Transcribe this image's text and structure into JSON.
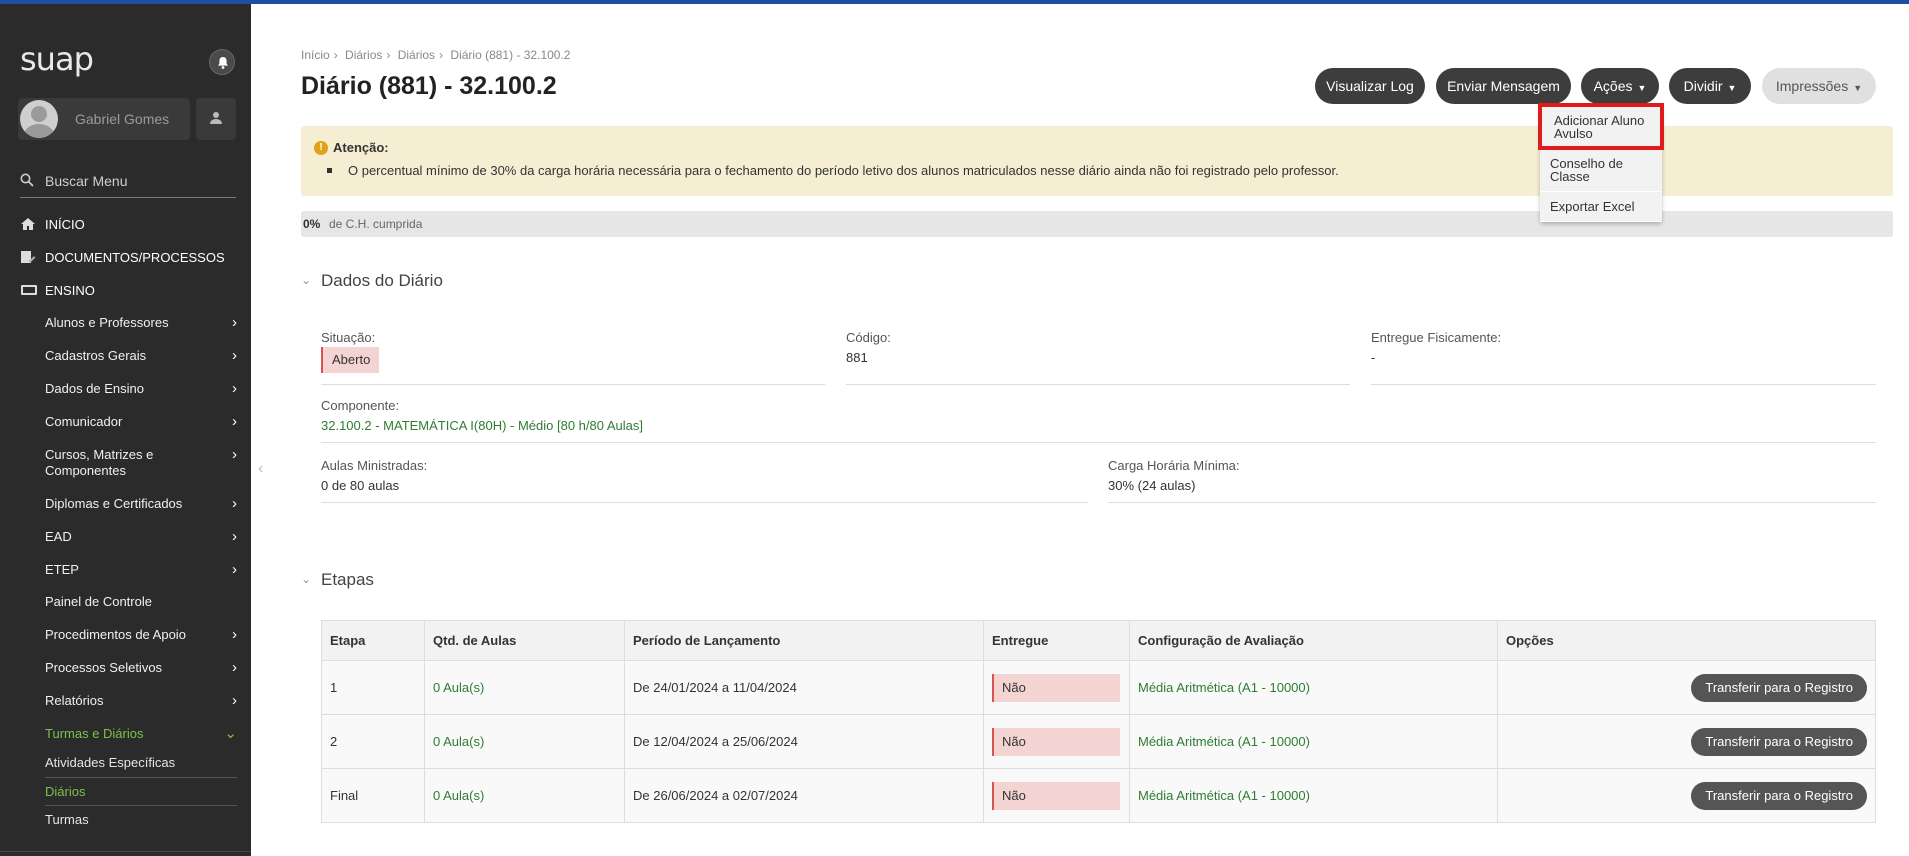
{
  "app": {
    "logo": "suap"
  },
  "user": {
    "name": "Gabriel Gomes"
  },
  "sidebar": {
    "search_placeholder": "Buscar Menu",
    "top_items": [
      {
        "label": "INÍCIO",
        "icon": "home-icon"
      },
      {
        "label": "DOCUMENTOS/PROCESSOS",
        "icon": "document-edit-icon"
      },
      {
        "label": "ENSINO",
        "icon": "ensino-icon"
      }
    ],
    "ensino_items": [
      "Alunos e Professores",
      "Cadastros Gerais",
      "Dados de Ensino",
      "Comunicador",
      "Cursos, Matrizes e Componentes",
      "Diplomas e Certificados",
      "EAD",
      "ETEP",
      "Painel de Controle",
      "Procedimentos de Apoio",
      "Processos Seletivos",
      "Relatórios",
      "Turmas e Diários"
    ],
    "turmas_sub": [
      "Atividades Específicas",
      "Diários",
      "Turmas"
    ]
  },
  "breadcrumb": [
    "Início",
    "Diários",
    "Diários",
    "Diário (881) - 32.100.2"
  ],
  "page_title": "Diário (881) - 32.100.2",
  "actions": {
    "visualizar_log": "Visualizar Log",
    "enviar_mensagem": "Enviar Mensagem",
    "acoes": "Ações",
    "dividir": "Dividir",
    "impressoes": "Impressões"
  },
  "acoes_menu": [
    "Adicionar Aluno Avulso",
    "Conselho de Classe",
    "Exportar Excel"
  ],
  "alert": {
    "title": "Atenção:",
    "message": "O percentual mínimo de 30% da carga horária necessária para o fechamento do período letivo dos alunos matriculados nesse diário ainda não foi registrado pelo professor."
  },
  "progress": {
    "percent": "0%",
    "label": "de C.H. cumprida"
  },
  "dados": {
    "title": "Dados do Diário",
    "situacao_label": "Situação:",
    "situacao_value": "Aberto",
    "codigo_label": "Código:",
    "codigo_value": "881",
    "entregue_label": "Entregue Fisicamente:",
    "entregue_value": "-",
    "componente_label": "Componente:",
    "componente_value": "32.100.2 - MATEMÁTICA I(80H) - Médio [80 h/80 Aulas]",
    "aulas_label": "Aulas Ministradas:",
    "aulas_value": "0 de 80 aulas",
    "carga_label": "Carga Horária Mínima:",
    "carga_value": "30% (24 aulas)"
  },
  "etapas": {
    "title": "Etapas",
    "headers": [
      "Etapa",
      "Qtd. de Aulas",
      "Período de Lançamento",
      "Entregue",
      "Configuração de Avaliação",
      "Opções"
    ],
    "rows": [
      {
        "etapa": "1",
        "aulas": "0 Aula(s)",
        "periodo": "De 24/01/2024 a 11/04/2024",
        "entregue": "Não",
        "config": "Média Aritmética (A1 - 10000)",
        "opcao": "Transferir para o Registro"
      },
      {
        "etapa": "2",
        "aulas": "0 Aula(s)",
        "periodo": "De 12/04/2024 a 25/06/2024",
        "entregue": "Não",
        "config": "Média Aritmética (A1 - 10000)",
        "opcao": "Transferir para o Registro"
      },
      {
        "etapa": "Final",
        "aulas": "0 Aula(s)",
        "periodo": "De 26/06/2024 a 02/07/2024",
        "entregue": "Não",
        "config": "Média Aritmética (A1 - 10000)",
        "opcao": "Transferir para o Registro"
      }
    ]
  },
  "colors": {
    "accent_green": "#2e7d32",
    "sidebar_bg": "#2b2b2b",
    "highlight_red": "#e01b1b"
  }
}
